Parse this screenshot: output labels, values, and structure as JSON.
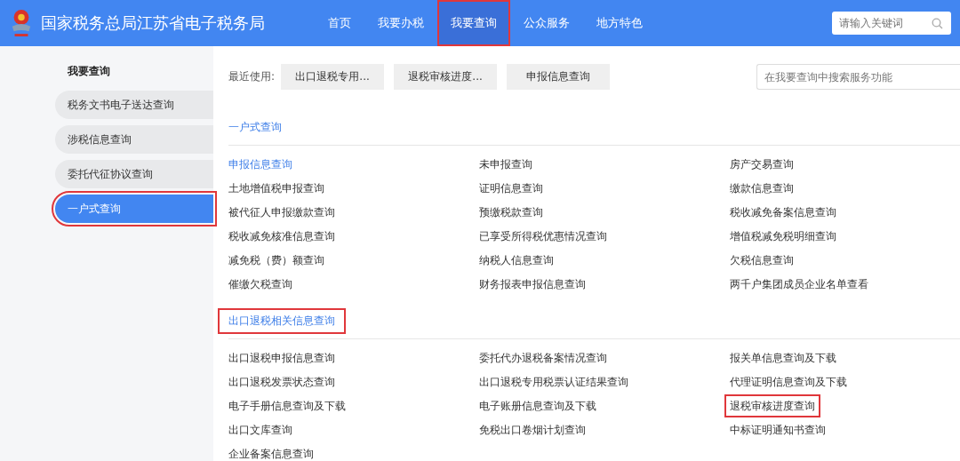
{
  "header": {
    "title": "国家税务总局江苏省电子税务局",
    "nav": [
      {
        "label": "首页",
        "selected": false,
        "annotated": false
      },
      {
        "label": "我要办税",
        "selected": false,
        "annotated": false
      },
      {
        "label": "我要查询",
        "selected": true,
        "annotated": true
      },
      {
        "label": "公众服务",
        "selected": false,
        "annotated": false
      },
      {
        "label": "地方特色",
        "selected": false,
        "annotated": false
      }
    ],
    "search": {
      "placeholder": "请输入关键词"
    }
  },
  "sidebar": {
    "title": "我要查询",
    "items": [
      {
        "label": "税务文书电子送达查询",
        "selected": false,
        "annotated": false
      },
      {
        "label": "涉税信息查询",
        "selected": false,
        "annotated": false
      },
      {
        "label": "委托代征协议查询",
        "selected": false,
        "annotated": false
      },
      {
        "label": "一户式查询",
        "selected": true,
        "annotated": true
      }
    ]
  },
  "recent": {
    "label": "最近使用:",
    "items": [
      "出口退税专用...",
      "退税审核进度...",
      "申报信息查询"
    ],
    "search": {
      "placeholder": "在我要查询中搜索服务功能"
    }
  },
  "sections": [
    {
      "title": "一户式查询",
      "annotated": false,
      "items": [
        {
          "label": "申报信息查询",
          "selected": true,
          "annotated": false
        },
        {
          "label": "未申报查询",
          "selected": false,
          "annotated": false
        },
        {
          "label": "房产交易查询",
          "selected": false,
          "annotated": false
        },
        {
          "label": "土地增值税申报查询",
          "selected": false,
          "annotated": false
        },
        {
          "label": "证明信息查询",
          "selected": false,
          "annotated": false
        },
        {
          "label": "缴款信息查询",
          "selected": false,
          "annotated": false
        },
        {
          "label": "被代征人申报缴款查询",
          "selected": false,
          "annotated": false
        },
        {
          "label": "预缴税款查询",
          "selected": false,
          "annotated": false
        },
        {
          "label": "税收减免备案信息查询",
          "selected": false,
          "annotated": false
        },
        {
          "label": "税收减免核准信息查询",
          "selected": false,
          "annotated": false
        },
        {
          "label": "已享受所得税优惠情况查询",
          "selected": false,
          "annotated": false
        },
        {
          "label": "增值税减免税明细查询",
          "selected": false,
          "annotated": false
        },
        {
          "label": "减免税（费）额查询",
          "selected": false,
          "annotated": false
        },
        {
          "label": "纳税人信息查询",
          "selected": false,
          "annotated": false
        },
        {
          "label": "欠税信息查询",
          "selected": false,
          "annotated": false
        },
        {
          "label": "催缴欠税查询",
          "selected": false,
          "annotated": false
        },
        {
          "label": "财务报表申报信息查询",
          "selected": false,
          "annotated": false
        },
        {
          "label": "两千户集团成员企业名单查看",
          "selected": false,
          "annotated": false
        }
      ]
    },
    {
      "title": "出口退税相关信息查询",
      "annotated": true,
      "items": [
        {
          "label": "出口退税申报信息查询",
          "selected": false,
          "annotated": false
        },
        {
          "label": "委托代办退税备案情况查询",
          "selected": false,
          "annotated": false
        },
        {
          "label": "报关单信息查询及下载",
          "selected": false,
          "annotated": false
        },
        {
          "label": "出口退税发票状态查询",
          "selected": false,
          "annotated": false
        },
        {
          "label": "出口退税专用税票认证结果查询",
          "selected": false,
          "annotated": false
        },
        {
          "label": "代理证明信息查询及下载",
          "selected": false,
          "annotated": false
        },
        {
          "label": "电子手册信息查询及下载",
          "selected": false,
          "annotated": false
        },
        {
          "label": "电子账册信息查询及下载",
          "selected": false,
          "annotated": false
        },
        {
          "label": "退税审核进度查询",
          "selected": false,
          "annotated": true
        },
        {
          "label": "出口文库查询",
          "selected": false,
          "annotated": false
        },
        {
          "label": "免税出口卷烟计划查询",
          "selected": false,
          "annotated": false
        },
        {
          "label": "中标证明通知书查询",
          "selected": false,
          "annotated": false
        },
        {
          "label": "企业备案信息查询",
          "selected": false,
          "annotated": false
        }
      ]
    }
  ]
}
